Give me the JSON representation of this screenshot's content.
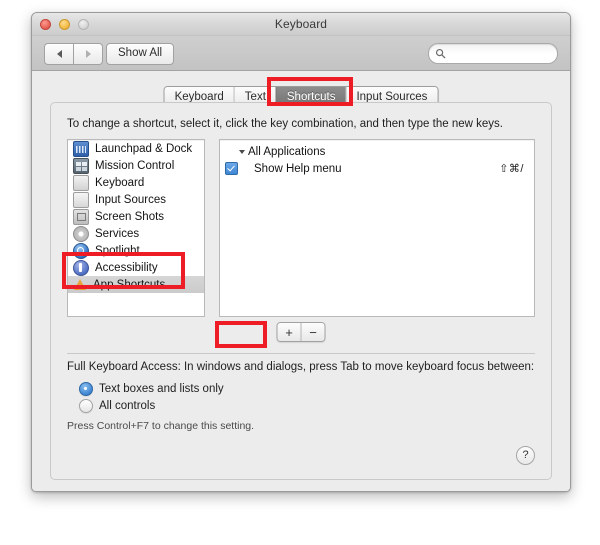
{
  "window": {
    "title": "Keyboard",
    "traffic_lights": [
      "close",
      "minimize",
      "zoom"
    ]
  },
  "toolbar": {
    "back_label": "back-arrow",
    "forward_label": "forward-arrow",
    "show_all_label": "Show All",
    "search_value": "",
    "search_placeholder": ""
  },
  "tabs": [
    {
      "label": "Keyboard",
      "active": false
    },
    {
      "label": "Text",
      "active": false
    },
    {
      "label": "Shortcuts",
      "active": true
    },
    {
      "label": "Input Sources",
      "active": false
    }
  ],
  "instruction": "To change a shortcut, select it, click the key combination, and then type the new keys.",
  "sidebar": {
    "items": [
      {
        "label": "Launchpad & Dock",
        "icon": "launchpad-icon",
        "selected": false
      },
      {
        "label": "Mission Control",
        "icon": "mission-control-icon",
        "selected": false
      },
      {
        "label": "Keyboard",
        "icon": "keyboard-icon",
        "selected": false
      },
      {
        "label": "Input Sources",
        "icon": "input-sources-icon",
        "selected": false
      },
      {
        "label": "Screen Shots",
        "icon": "screenshot-icon",
        "selected": false
      },
      {
        "label": "Services",
        "icon": "gear-icon",
        "selected": false
      },
      {
        "label": "Spotlight",
        "icon": "spotlight-icon",
        "selected": false
      },
      {
        "label": "Accessibility",
        "icon": "accessibility-icon",
        "selected": false
      },
      {
        "label": "App Shortcuts",
        "icon": "app-shortcuts-icon",
        "selected": true
      }
    ]
  },
  "detail": {
    "group_label": "All Applications",
    "rows": [
      {
        "label": "Show Help menu",
        "shortcut": "⇧⌘/",
        "checked": true
      }
    ]
  },
  "list_buttons": {
    "add_label": "+",
    "remove_label": "−"
  },
  "full_keyboard_access": {
    "label": "Full Keyboard Access: In windows and dialogs, press Tab to move keyboard focus between:",
    "options": [
      {
        "label": "Text boxes and lists only",
        "selected": true
      },
      {
        "label": "All controls",
        "selected": false
      }
    ],
    "hint": "Press Control+F7 to change this setting."
  },
  "help": {
    "label": "?"
  },
  "colors": {
    "annotation": "#ee1c25",
    "accent_blue": "#3f86d4",
    "tab_active_bg": "#737373",
    "window_bg": "#ececec"
  }
}
